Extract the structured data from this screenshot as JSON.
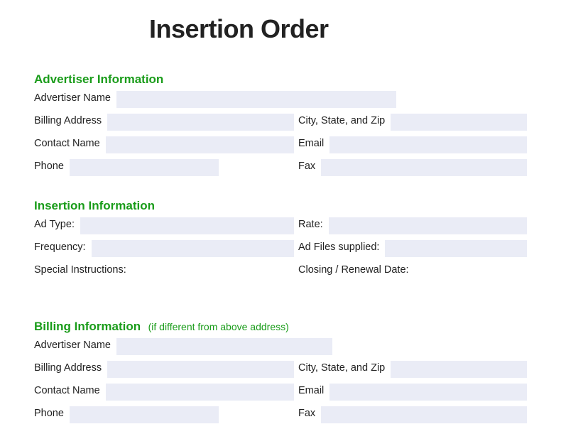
{
  "title": "Insertion Order",
  "sections": {
    "advertiser": {
      "heading": "Advertiser Information",
      "fields": {
        "advertiser_name": "Advertiser Name",
        "billing_address": "Billing Address",
        "city_state_zip": "City, State, and Zip",
        "contact_name": "Contact Name",
        "email": "Email",
        "phone": "Phone",
        "fax": "Fax"
      }
    },
    "insertion": {
      "heading": "Insertion Information",
      "fields": {
        "ad_type": "Ad Type:",
        "rate": "Rate:",
        "frequency": "Frequency:",
        "ad_files_supplied": "Ad Files supplied:",
        "special_instructions": "Special Instructions:",
        "closing_renewal_date": "Closing / Renewal Date:"
      }
    },
    "billing": {
      "heading": "Billing Information",
      "subtitle": "(if different from above address)",
      "fields": {
        "advertiser_name": "Advertiser Name",
        "billing_address": "Billing Address",
        "city_state_zip": "City, State, and Zip",
        "contact_name": "Contact Name",
        "email": "Email",
        "phone": "Phone",
        "fax": "Fax"
      }
    }
  }
}
